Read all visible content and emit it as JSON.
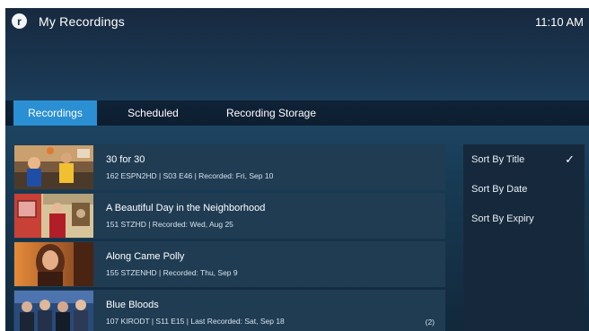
{
  "header": {
    "logo_letter": "r",
    "title": "My Recordings",
    "time": "11:10 AM"
  },
  "tabs": [
    {
      "label": "Recordings",
      "active": true
    },
    {
      "label": "Scheduled",
      "active": false
    },
    {
      "label": "Recording Storage",
      "active": false
    }
  ],
  "recordings": [
    {
      "title": "30 for 30",
      "meta": "162 ESPN2HD  |  S03 E46  |  Recorded: Fri, Sep 10",
      "count": ""
    },
    {
      "title": "A Beautiful Day in the Neighborhood",
      "meta": "151 STZHD  |  Recorded: Wed, Aug 25",
      "count": ""
    },
    {
      "title": "Along Came Polly",
      "meta": "155 STZENHD  |  Recorded: Thu, Sep 9",
      "count": ""
    },
    {
      "title": "Blue Bloods",
      "meta": "107 KIRODT  |  S11 E15  |  Last Recorded: Sat, Sep 18",
      "count": "(2)"
    }
  ],
  "sort_options": [
    {
      "label": "Sort By Title",
      "selected": true,
      "check": "✓"
    },
    {
      "label": "Sort By Date",
      "selected": false,
      "check": ""
    },
    {
      "label": "Sort By Expiry",
      "selected": false,
      "check": ""
    }
  ],
  "colors": {
    "accent": "#2a8fd3",
    "row_bg": "#1f3c53",
    "panel_bg": "#16293c"
  }
}
